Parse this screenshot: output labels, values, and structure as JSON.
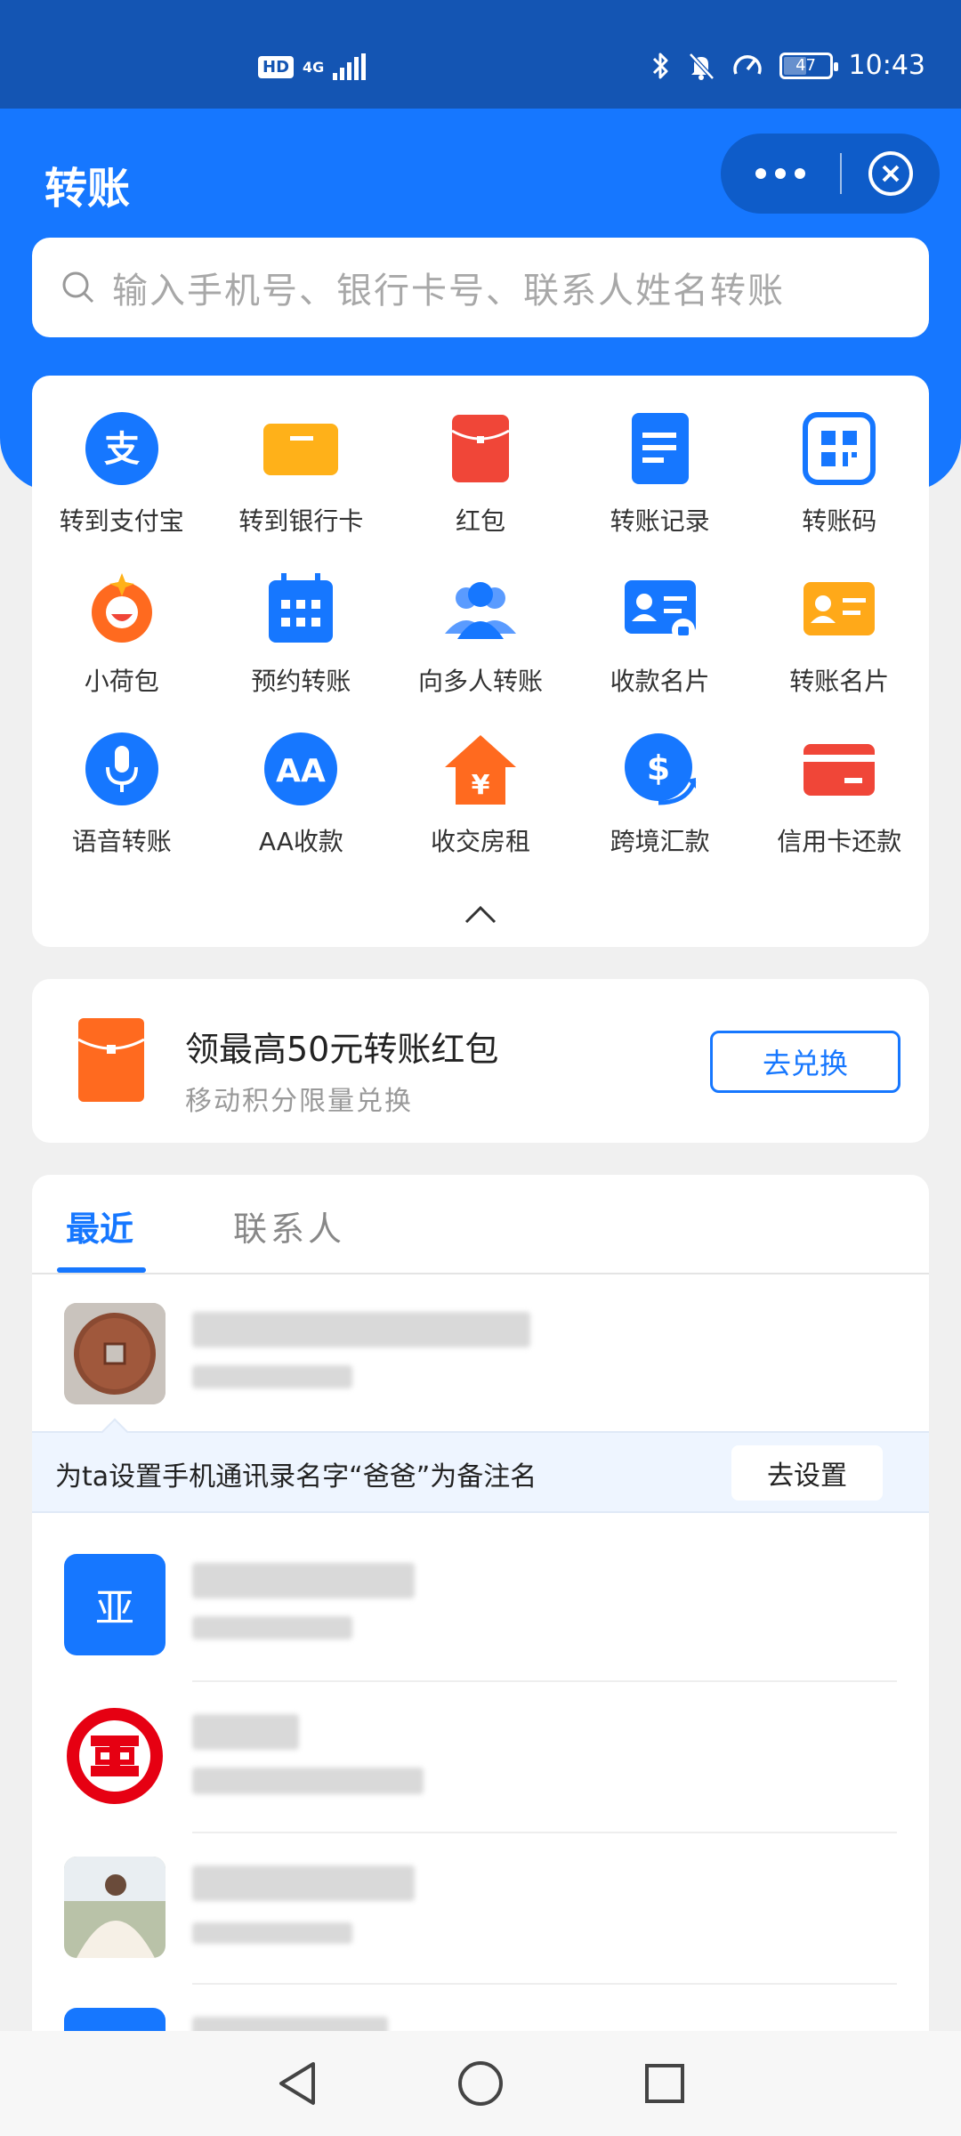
{
  "status_bar": {
    "hd": "HD",
    "network": "4G",
    "battery_level": "47",
    "battery_fraction": 0.47,
    "time": "10:43"
  },
  "header": {
    "title": "转账",
    "more_icon": "more-dots-icon",
    "close_icon": "close-circle-icon"
  },
  "search": {
    "placeholder": "输入手机号、银行卡号、联系人姓名转账",
    "icon": "search-icon"
  },
  "functions": [
    {
      "label": "转到支付宝",
      "icon": "alipay-icon"
    },
    {
      "label": "转到银行卡",
      "icon": "bank-card-icon"
    },
    {
      "label": "红包",
      "icon": "red-envelope-icon"
    },
    {
      "label": "转账记录",
      "icon": "record-icon"
    },
    {
      "label": "转账码",
      "icon": "qr-code-icon"
    },
    {
      "label": "小荷包",
      "icon": "purse-icon"
    },
    {
      "label": "预约转账",
      "icon": "calendar-icon"
    },
    {
      "label": "向多人转账",
      "icon": "group-icon"
    },
    {
      "label": "收款名片",
      "icon": "receive-card-icon"
    },
    {
      "label": "转账名片",
      "icon": "transfer-card-icon"
    },
    {
      "label": "语音转账",
      "icon": "microphone-icon"
    },
    {
      "label": "AA收款",
      "icon": "aa-icon"
    },
    {
      "label": "收交房租",
      "icon": "house-rent-icon"
    },
    {
      "label": "跨境汇款",
      "icon": "cross-border-icon"
    },
    {
      "label": "信用卡还款",
      "icon": "credit-card-icon"
    }
  ],
  "promo": {
    "title": "领最高50元转账红包",
    "subtitle": "移动积分限量兑换",
    "button": "去兑换"
  },
  "tabs": {
    "recent": "最近",
    "contacts": "联系人"
  },
  "remark": {
    "text": "为ta设置手机通讯录名字“爸爸”为备注名",
    "button": "去设置"
  },
  "contacts": [
    {
      "avatar": "coin-avatar"
    },
    {
      "avatar_text": "亚"
    },
    {
      "avatar": "bank-logo-avatar"
    },
    {
      "avatar": "photo-avatar"
    }
  ],
  "colors": {
    "primary": "#1677ff",
    "status_bar": "#1455b3",
    "orange": "#ff6a1f",
    "red": "#f04638",
    "yellow": "#ffa919"
  }
}
